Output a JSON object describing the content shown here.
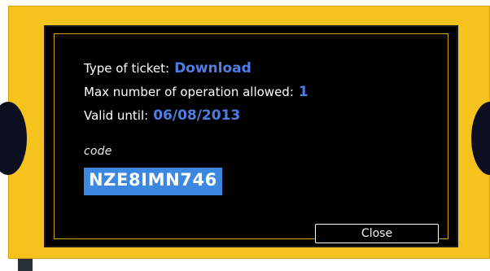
{
  "dialog": {
    "ticket_type": {
      "label": "Type of ticket:",
      "value": "Download"
    },
    "max_operations": {
      "label": "Max number of operation allowed:",
      "value": "1"
    },
    "valid_until": {
      "label": "Valid until:",
      "value": "06/08/2013"
    },
    "code": {
      "label": "code",
      "value": "NZE8IMN746"
    },
    "close_label": "Close"
  },
  "colors": {
    "ticket_yellow": "#f6c21d",
    "panel_black": "#000000",
    "value_blue": "#4f7de6",
    "selection_blue": "#3c87df",
    "frame_gold": "#d2a11a"
  }
}
